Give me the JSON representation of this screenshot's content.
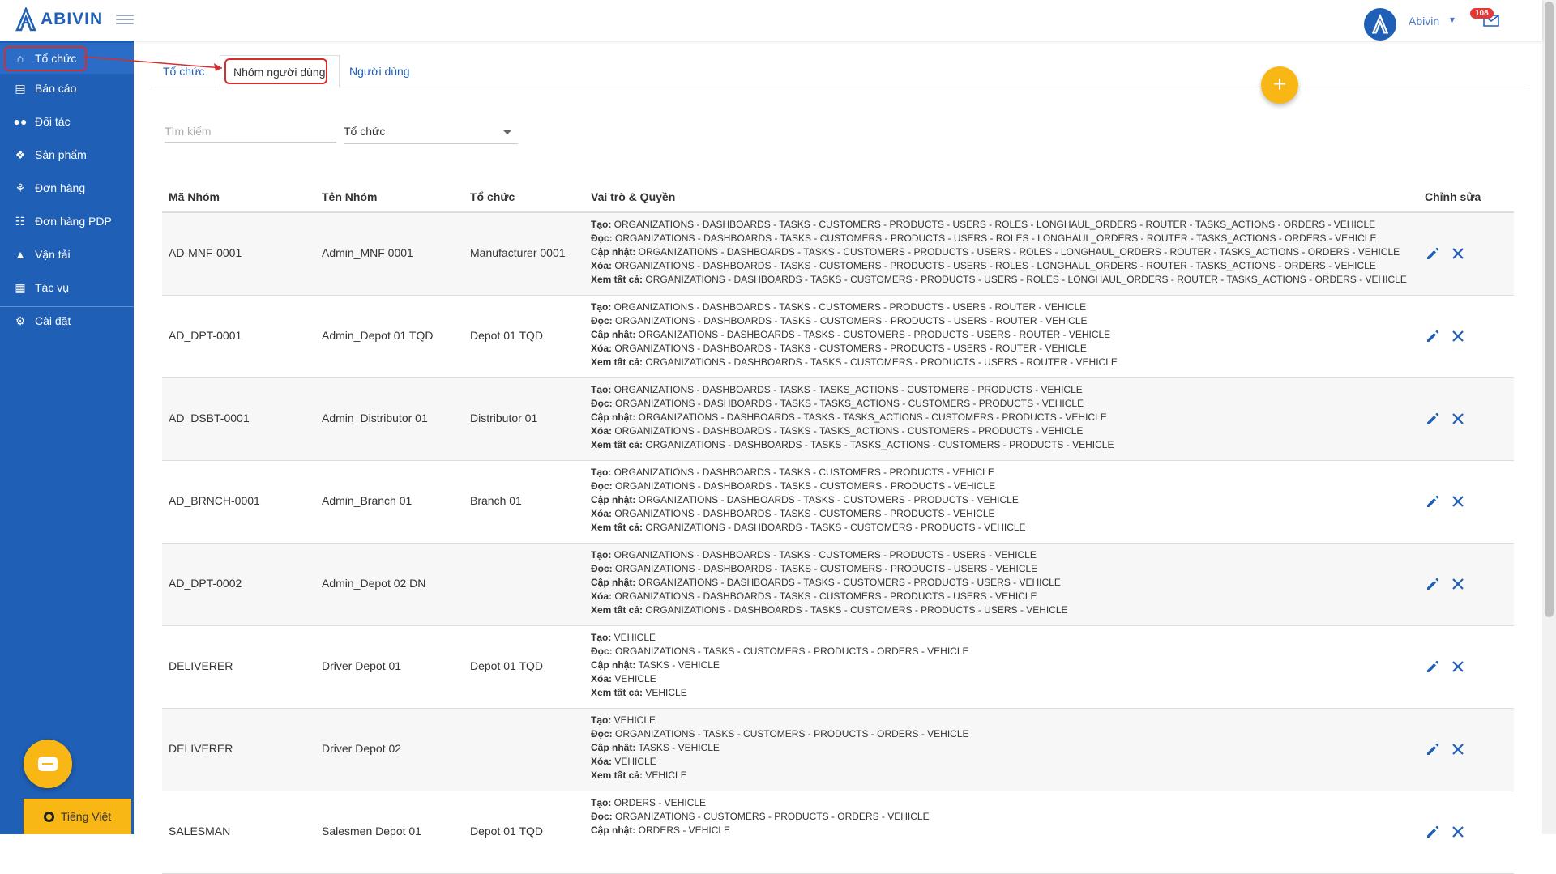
{
  "app": {
    "logo_text": "ABIVIN",
    "user_name": "Abivin",
    "notification_count": "108"
  },
  "sidebar": {
    "items": [
      {
        "label": "Tổ chức",
        "icon": "home-icon"
      },
      {
        "label": "Báo cáo",
        "icon": "bar-chart-icon"
      },
      {
        "label": "Đối tác",
        "icon": "users-icon"
      },
      {
        "label": "Sản phẩm",
        "icon": "boxes-icon"
      },
      {
        "label": "Đơn hàng",
        "icon": "cubes-icon"
      },
      {
        "label": "Đơn hàng PDP",
        "icon": "list-icon"
      },
      {
        "label": "Vận tải",
        "icon": "road-icon"
      },
      {
        "label": "Tác vụ",
        "icon": "calendar-icon"
      },
      {
        "label": "Cài đặt",
        "icon": "gear-icon"
      }
    ],
    "language": "Tiếng Việt"
  },
  "tabs": [
    {
      "label": "Tổ chức"
    },
    {
      "label": "Nhóm người dùng"
    },
    {
      "label": "Người dùng"
    }
  ],
  "filters": {
    "search_placeholder": "Tìm kiếm",
    "org_select": "Tổ chức"
  },
  "table": {
    "headers": {
      "code": "Mã Nhóm",
      "name": "Tên Nhóm",
      "org": "Tổ chức",
      "roles": "Vai trò & Quyền",
      "edit": "Chỉnh sửa"
    },
    "perm_labels": {
      "create": "Tạo:",
      "read": "Đọc:",
      "update": "Cập nhật:",
      "delete": "Xóa:",
      "view_all": "Xem tất cả:"
    },
    "rows": [
      {
        "code": "AD-MNF-0001",
        "name": "Admin_MNF 0001",
        "org": "Manufacturer 0001",
        "create": " ORGANIZATIONS - DASHBOARDS - TASKS - CUSTOMERS - PRODUCTS - USERS - ROLES - LONGHAUL_ORDERS - ROUTER - TASKS_ACTIONS - ORDERS - VEHICLE",
        "read": " ORGANIZATIONS - DASHBOARDS - TASKS - CUSTOMERS - PRODUCTS - USERS - ROLES - LONGHAUL_ORDERS - ROUTER - TASKS_ACTIONS - ORDERS - VEHICLE",
        "update": " ORGANIZATIONS - DASHBOARDS - TASKS - CUSTOMERS - PRODUCTS - USERS - ROLES - LONGHAUL_ORDERS - ROUTER - TASKS_ACTIONS - ORDERS - VEHICLE",
        "delete": " ORGANIZATIONS - DASHBOARDS - TASKS - CUSTOMERS - PRODUCTS - USERS - ROLES - LONGHAUL_ORDERS - ROUTER - TASKS_ACTIONS - ORDERS - VEHICLE",
        "view_all": " ORGANIZATIONS - DASHBOARDS - TASKS - CUSTOMERS - PRODUCTS - USERS - ROLES - LONGHAUL_ORDERS - ROUTER - TASKS_ACTIONS - ORDERS - VEHICLE"
      },
      {
        "code": "AD_DPT-0001",
        "name": "Admin_Depot 01 TQD",
        "org": "Depot 01 TQD",
        "create": " ORGANIZATIONS - DASHBOARDS - TASKS - CUSTOMERS - PRODUCTS - USERS - ROUTER - VEHICLE",
        "read": " ORGANIZATIONS - DASHBOARDS - TASKS - CUSTOMERS - PRODUCTS - USERS - ROUTER - VEHICLE",
        "update": " ORGANIZATIONS - DASHBOARDS - TASKS - CUSTOMERS - PRODUCTS - USERS - ROUTER - VEHICLE",
        "delete": " ORGANIZATIONS - DASHBOARDS - TASKS - CUSTOMERS - PRODUCTS - USERS - ROUTER - VEHICLE",
        "view_all": " ORGANIZATIONS - DASHBOARDS - TASKS - CUSTOMERS - PRODUCTS - USERS - ROUTER - VEHICLE"
      },
      {
        "code": "AD_DSBT-0001",
        "name": "Admin_Distributor 01",
        "org": "Distributor 01",
        "create": " ORGANIZATIONS - DASHBOARDS - TASKS - TASKS_ACTIONS - CUSTOMERS - PRODUCTS - VEHICLE",
        "read": " ORGANIZATIONS - DASHBOARDS - TASKS - TASKS_ACTIONS - CUSTOMERS - PRODUCTS - VEHICLE",
        "update": " ORGANIZATIONS - DASHBOARDS - TASKS - TASKS_ACTIONS - CUSTOMERS - PRODUCTS - VEHICLE",
        "delete": " ORGANIZATIONS - DASHBOARDS - TASKS - TASKS_ACTIONS - CUSTOMERS - PRODUCTS - VEHICLE",
        "view_all": " ORGANIZATIONS - DASHBOARDS - TASKS - TASKS_ACTIONS - CUSTOMERS - PRODUCTS - VEHICLE"
      },
      {
        "code": "AD_BRNCH-0001",
        "name": "Admin_Branch 01",
        "org": "Branch 01",
        "create": " ORGANIZATIONS - DASHBOARDS - TASKS - CUSTOMERS - PRODUCTS - VEHICLE",
        "read": " ORGANIZATIONS - DASHBOARDS - TASKS - CUSTOMERS - PRODUCTS - VEHICLE",
        "update": " ORGANIZATIONS - DASHBOARDS - TASKS - CUSTOMERS - PRODUCTS - VEHICLE",
        "delete": " ORGANIZATIONS - DASHBOARDS - TASKS - CUSTOMERS - PRODUCTS - VEHICLE",
        "view_all": " ORGANIZATIONS - DASHBOARDS - TASKS - CUSTOMERS - PRODUCTS - VEHICLE"
      },
      {
        "code": "AD_DPT-0002",
        "name": "Admin_Depot 02 DN",
        "org": "",
        "create": " ORGANIZATIONS - DASHBOARDS - TASKS - CUSTOMERS - PRODUCTS - USERS - VEHICLE",
        "read": " ORGANIZATIONS - DASHBOARDS - TASKS - CUSTOMERS - PRODUCTS - USERS - VEHICLE",
        "update": " ORGANIZATIONS - DASHBOARDS - TASKS - CUSTOMERS - PRODUCTS - USERS - VEHICLE",
        "delete": " ORGANIZATIONS - DASHBOARDS - TASKS - CUSTOMERS - PRODUCTS - USERS - VEHICLE",
        "view_all": " ORGANIZATIONS - DASHBOARDS - TASKS - CUSTOMERS - PRODUCTS - USERS - VEHICLE"
      },
      {
        "code": "DELIVERER",
        "name": "Driver Depot 01",
        "org": "Depot 01 TQD",
        "create": " VEHICLE",
        "read": " ORGANIZATIONS - TASKS - CUSTOMERS - PRODUCTS - ORDERS - VEHICLE",
        "update": " TASKS - VEHICLE",
        "delete": " VEHICLE",
        "view_all": " VEHICLE"
      },
      {
        "code": "DELIVERER",
        "name": "Driver Depot 02",
        "org": "",
        "create": " VEHICLE",
        "read": " ORGANIZATIONS - TASKS - CUSTOMERS - PRODUCTS - ORDERS - VEHICLE",
        "update": " TASKS - VEHICLE",
        "delete": " VEHICLE",
        "view_all": " VEHICLE"
      },
      {
        "code": "SALESMAN",
        "name": "Salesmen Depot 01",
        "org": "Depot 01 TQD",
        "create": " ORDERS - VEHICLE",
        "read": " ORGANIZATIONS - CUSTOMERS - PRODUCTS - ORDERS - VEHICLE",
        "update": " ORDERS - VEHICLE",
        "delete": "",
        "view_all": ""
      }
    ]
  },
  "colors": {
    "primary": "#1f5fb5",
    "accent": "#f9b715",
    "highlight": "#d32f2f"
  }
}
